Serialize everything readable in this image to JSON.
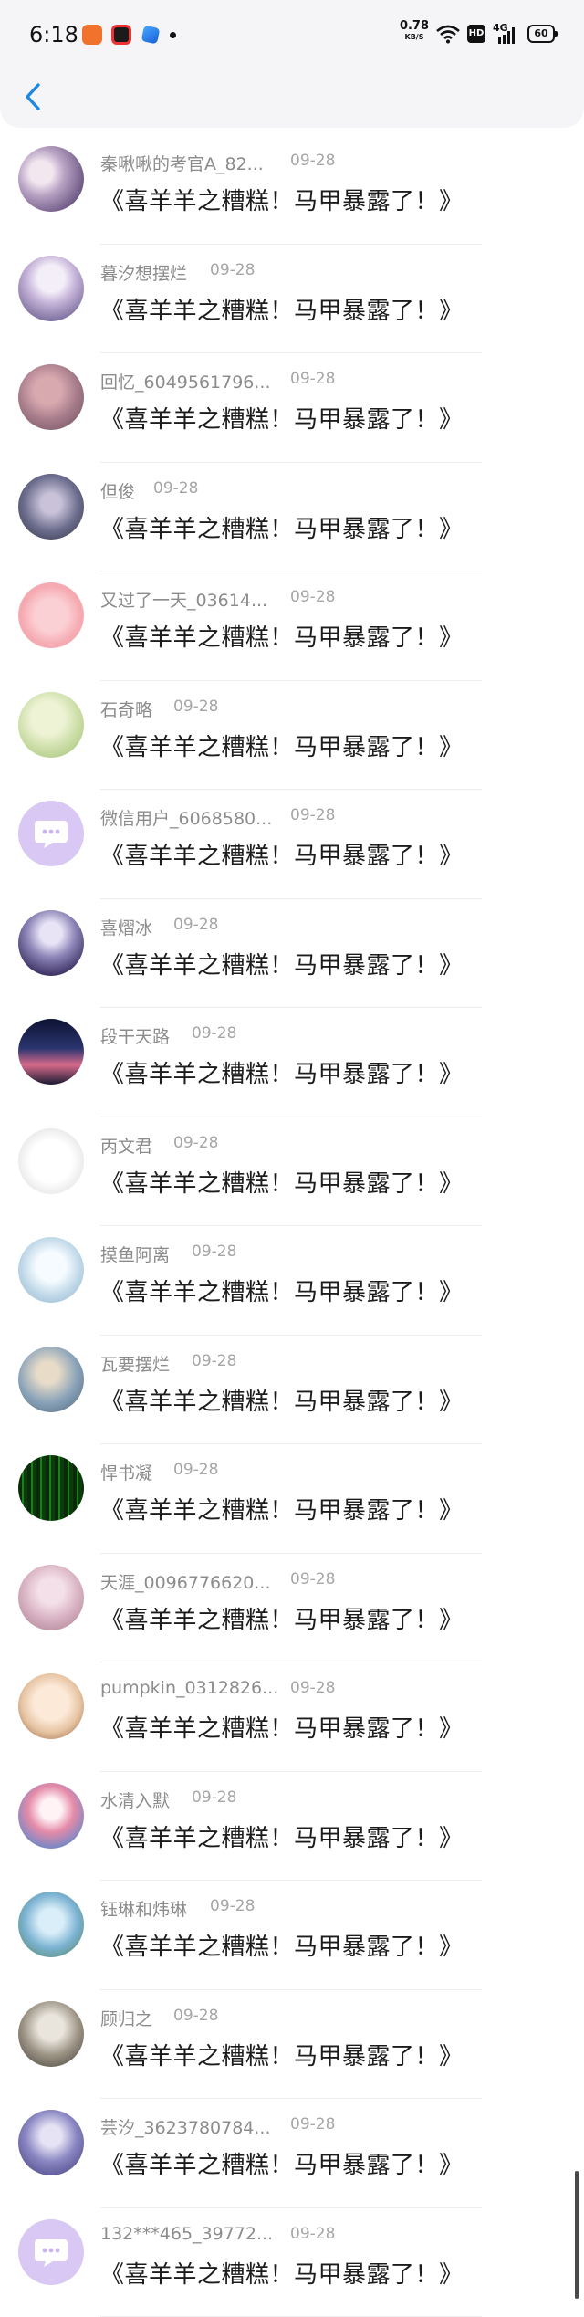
{
  "status_bar": {
    "time": "6:18",
    "net_speed": "0.78",
    "net_unit": "KB/S",
    "hd_label": "HD",
    "signal_label": "4G",
    "battery": "60"
  },
  "header": {
    "back_icon": "chevron-left-icon",
    "accent": "#1e88e5"
  },
  "comments": [
    {
      "user": "秦啾啾的考官A_82...",
      "date": "09-28",
      "book": "《喜羊羊之糟糕！马甲暴露了！》"
    },
    {
      "user": "暮汐想摆烂",
      "date": "09-28",
      "book": "《喜羊羊之糟糕！马甲暴露了！》"
    },
    {
      "user": "回忆_6049561796...",
      "date": "09-28",
      "book": "《喜羊羊之糟糕！马甲暴露了！》"
    },
    {
      "user": "但俊",
      "date": "09-28",
      "book": "《喜羊羊之糟糕！马甲暴露了！》"
    },
    {
      "user": "又过了一天_03614...",
      "date": "09-28",
      "book": "《喜羊羊之糟糕！马甲暴露了！》"
    },
    {
      "user": "石奇略",
      "date": "09-28",
      "book": "《喜羊羊之糟糕！马甲暴露了！》"
    },
    {
      "user": "微信用户_6068580...",
      "date": "09-28",
      "book": "《喜羊羊之糟糕！马甲暴露了！》"
    },
    {
      "user": "喜熠冰",
      "date": "09-28",
      "book": "《喜羊羊之糟糕！马甲暴露了！》"
    },
    {
      "user": "段干天路",
      "date": "09-28",
      "book": "《喜羊羊之糟糕！马甲暴露了！》"
    },
    {
      "user": "丙文君",
      "date": "09-28",
      "book": "《喜羊羊之糟糕！马甲暴露了！》"
    },
    {
      "user": "摸鱼阿离",
      "date": "09-28",
      "book": "《喜羊羊之糟糕！马甲暴露了！》"
    },
    {
      "user": "瓦要摆烂",
      "date": "09-28",
      "book": "《喜羊羊之糟糕！马甲暴露了！》"
    },
    {
      "user": "悍书凝",
      "date": "09-28",
      "book": "《喜羊羊之糟糕！马甲暴露了！》"
    },
    {
      "user": "天涯_0096776620...",
      "date": "09-28",
      "book": "《喜羊羊之糟糕！马甲暴露了！》"
    },
    {
      "user": "pumpkin_0312826...",
      "date": "09-28",
      "book": "《喜羊羊之糟糕！马甲暴露了！》"
    },
    {
      "user": "水清入默",
      "date": "09-28",
      "book": "《喜羊羊之糟糕！马甲暴露了！》"
    },
    {
      "user": "钰琳和炜琳",
      "date": "09-28",
      "book": "《喜羊羊之糟糕！马甲暴露了！》"
    },
    {
      "user": "顾归之",
      "date": "09-28",
      "book": "《喜羊羊之糟糕！马甲暴露了！》"
    },
    {
      "user": "芸汐_3623780784...",
      "date": "09-28",
      "book": "《喜羊羊之糟糕！马甲暴露了！》"
    },
    {
      "user": "132***465_39772...",
      "date": "09-28",
      "book": "《喜羊羊之糟糕！马甲暴露了！》"
    }
  ]
}
